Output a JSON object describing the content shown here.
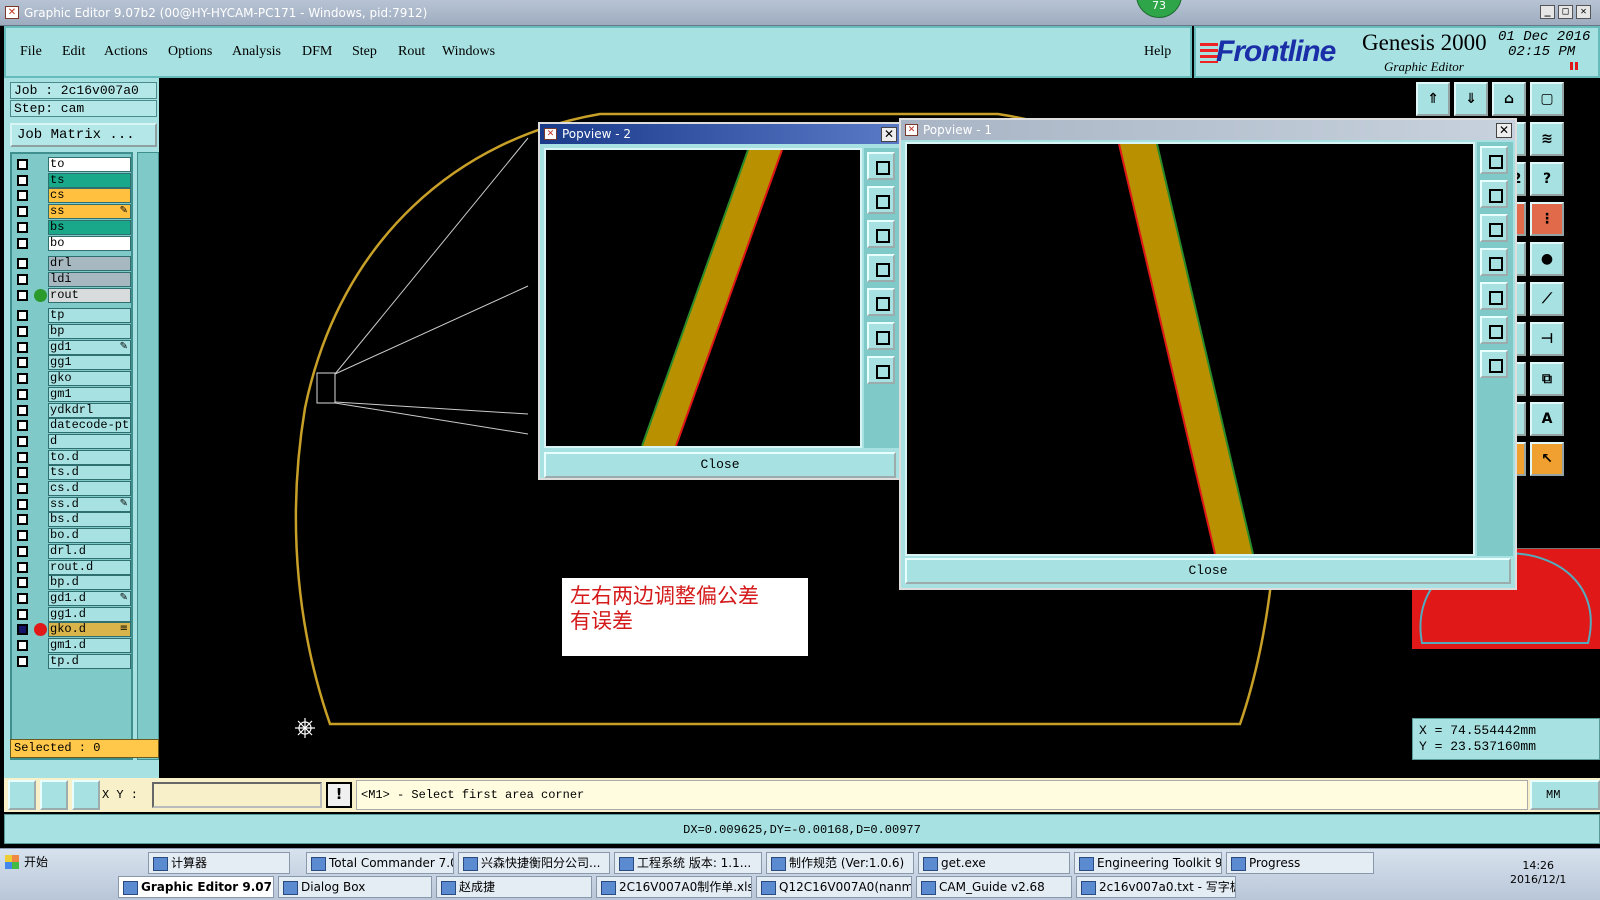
{
  "window": {
    "title": "Graphic Editor 9.07b2 (00@HY-HYCAM-PC171 - Windows, pid:7912)",
    "badge": "73",
    "min": "_",
    "max": "□",
    "close": "✕"
  },
  "menu": {
    "items": [
      "File",
      "Edit",
      "Actions",
      "Options",
      "Analysis",
      "DFM",
      "Step",
      "Rout",
      "Windows"
    ],
    "help": "Help"
  },
  "logo": {
    "brand": "Frontline",
    "product": "Genesis 2000",
    "subtitle": "Graphic Editor",
    "date": "01 Dec 2016",
    "time": "02:15 PM"
  },
  "left": {
    "job": "Job : 2c16v007a0",
    "step": "Step: cam",
    "job_matrix": "Job Matrix ...",
    "selected": "Selected : 0"
  },
  "layers": [
    {
      "name": "to",
      "color": "#ffffff",
      "checked": false,
      "dot": "",
      "mark": ""
    },
    {
      "name": "ts",
      "color": "#1aa88a",
      "checked": false,
      "dot": "",
      "mark": ""
    },
    {
      "name": "cs",
      "color": "#ffc040",
      "checked": false,
      "dot": "",
      "mark": ""
    },
    {
      "name": "ss",
      "color": "#ffc040",
      "checked": false,
      "dot": "",
      "mark": "✎"
    },
    {
      "name": "bs",
      "color": "#1aa88a",
      "checked": false,
      "dot": "",
      "mark": ""
    },
    {
      "name": "bo",
      "color": "#ffffff",
      "checked": false,
      "dot": "",
      "mark": ""
    },
    {
      "name": "drl",
      "color": "#a8b8c0",
      "checked": false,
      "dot": "",
      "mark": ""
    },
    {
      "name": "ldi",
      "color": "#a8b8c0",
      "checked": false,
      "dot": "",
      "mark": ""
    },
    {
      "name": "rout",
      "color": "#d8dcdc",
      "checked": false,
      "dot": "#2a9a2a",
      "mark": ""
    },
    {
      "name": "tp",
      "color": "#a7e1e1",
      "checked": false,
      "dot": "",
      "mark": ""
    },
    {
      "name": "bp",
      "color": "#a7e1e1",
      "checked": false,
      "dot": "",
      "mark": ""
    },
    {
      "name": "gd1",
      "color": "#a7e1e1",
      "checked": false,
      "dot": "",
      "mark": "✎"
    },
    {
      "name": "gg1",
      "color": "#a7e1e1",
      "checked": false,
      "dot": "",
      "mark": ""
    },
    {
      "name": "gko",
      "color": "#a7e1e1",
      "checked": false,
      "dot": "",
      "mark": ""
    },
    {
      "name": "gm1",
      "color": "#a7e1e1",
      "checked": false,
      "dot": "",
      "mark": ""
    },
    {
      "name": "ydkdrl",
      "color": "#a7e1e1",
      "checked": false,
      "dot": "",
      "mark": ""
    },
    {
      "name": "datecode-pt",
      "color": "#a7e1e1",
      "checked": false,
      "dot": "",
      "mark": ""
    },
    {
      "name": "d",
      "color": "#a7e1e1",
      "checked": false,
      "dot": "",
      "mark": ""
    },
    {
      "name": "to.d",
      "color": "#a7e1e1",
      "checked": false,
      "dot": "",
      "mark": ""
    },
    {
      "name": "ts.d",
      "color": "#a7e1e1",
      "checked": false,
      "dot": "",
      "mark": ""
    },
    {
      "name": "cs.d",
      "color": "#a7e1e1",
      "checked": false,
      "dot": "",
      "mark": ""
    },
    {
      "name": "ss.d",
      "color": "#a7e1e1",
      "checked": false,
      "dot": "",
      "mark": "✎"
    },
    {
      "name": "bs.d",
      "color": "#a7e1e1",
      "checked": false,
      "dot": "",
      "mark": ""
    },
    {
      "name": "bo.d",
      "color": "#a7e1e1",
      "checked": false,
      "dot": "",
      "mark": ""
    },
    {
      "name": "drl.d",
      "color": "#a7e1e1",
      "checked": false,
      "dot": "",
      "mark": ""
    },
    {
      "name": "rout.d",
      "color": "#a7e1e1",
      "checked": false,
      "dot": "",
      "mark": ""
    },
    {
      "name": "bp.d",
      "color": "#a7e1e1",
      "checked": false,
      "dot": "",
      "mark": ""
    },
    {
      "name": "gd1.d",
      "color": "#a7e1e1",
      "checked": false,
      "dot": "",
      "mark": "✎"
    },
    {
      "name": "gg1.d",
      "color": "#a7e1e1",
      "checked": false,
      "dot": "",
      "mark": ""
    },
    {
      "name": "gko.d",
      "color": "#d8b44a",
      "checked": true,
      "dot": "#e01818",
      "mark": "≡"
    },
    {
      "name": "gm1.d",
      "color": "#a7e1e1",
      "checked": false,
      "dot": "",
      "mark": ""
    },
    {
      "name": "tp.d",
      "color": "#a7e1e1",
      "checked": false,
      "dot": "",
      "mark": ""
    }
  ],
  "popview2": {
    "title": "Popview - 2",
    "close_label": "Close"
  },
  "popview1": {
    "title": "Popview - 1",
    "close_label": "Close"
  },
  "note": {
    "line1": "左右两边调整偏公差",
    "line2": "有误差"
  },
  "coords": {
    "x": "X  =  74.554442mm",
    "y": "Y  =  23.537160mm"
  },
  "command": {
    "xy_label": "X Y :",
    "xy_value": "",
    "warn": "!",
    "message": "<M1> - Select first area corner",
    "units": "MM"
  },
  "status": {
    "delta": "DX=0.009625,DY=-0.00168,D=0.00977"
  },
  "taskbar": {
    "start": "开始",
    "row1": [
      "计算器",
      "Total Commander 7.0 p...",
      "兴森快捷衡阳分公司...",
      "工程系统  版本: 1.1...",
      "制作规范 (Ver:1.0.6)",
      "get.exe",
      "Engineering Toolkit 9.0...",
      "Progress"
    ],
    "row2": [
      "Graphic Editor 9.07b2 ...",
      "Dialog Box",
      "赵成捷",
      "2C16V007A0制作单.xls ...",
      "Q12C16V007A0(nanmin)...",
      "CAM_Guide v2.68",
      "2c16v007a0.txt - 写字板"
    ],
    "time": "14:26",
    "date": "2016/12/1"
  },
  "colors": {
    "panel": "#a7e1e1",
    "profile": "#c8a028",
    "trace": "#b89000",
    "trace_edge_red": "#e01818",
    "trace_edge_green": "#2a8a2a"
  }
}
